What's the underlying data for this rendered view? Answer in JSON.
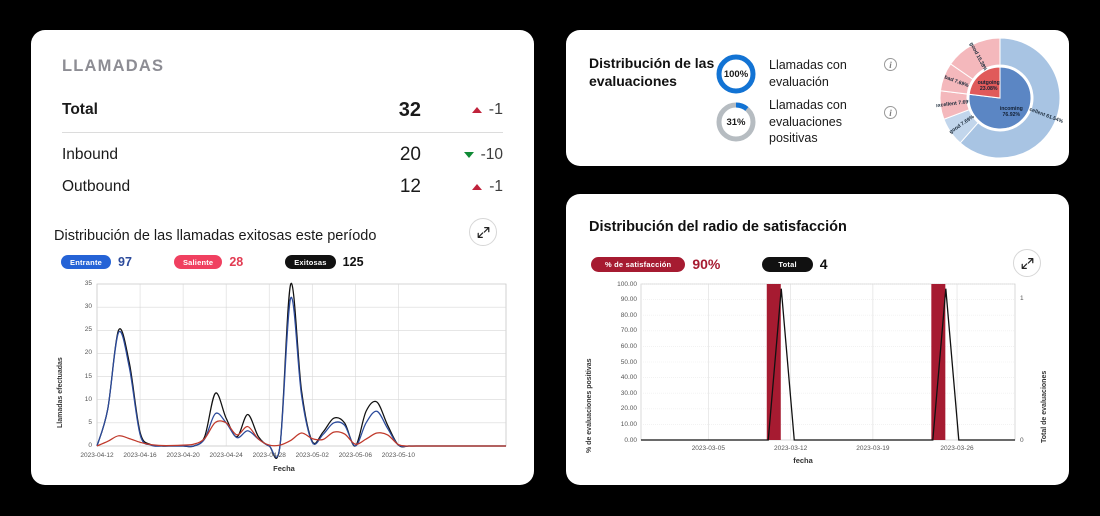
{
  "theme": {
    "background": "#000000",
    "card_bg": "#ffffff",
    "blue": "#1565c0",
    "red": "#e23b52",
    "black": "#111111",
    "crimson": "#a61b31",
    "green": "#0f8a35"
  },
  "calls_card": {
    "title": "LLAMADAS",
    "rows": [
      {
        "label": "Total",
        "value": "32",
        "delta": "-1",
        "trend": "up"
      },
      {
        "label": "Inbound",
        "value": "20",
        "delta": "-10",
        "trend": "down"
      },
      {
        "label": "Outbound",
        "value": "12",
        "delta": "-1",
        "trend": "up"
      }
    ],
    "chart_title": "Distribución de las llamadas exitosas este período",
    "expand_icon": "expand-diagonal-icon",
    "legend": [
      {
        "pill": "Entrante",
        "value": "97",
        "color": "#2563d6"
      },
      {
        "pill": "Saliente",
        "value": "28",
        "color": "#f04060"
      },
      {
        "pill": "Exitosas",
        "value": "125",
        "color": "#111111"
      }
    ]
  },
  "eval_card": {
    "title": "Distribución de las evaluaciones",
    "rows": [
      {
        "pct": "100%",
        "pct_num": 100,
        "label": "Llamadas con evaluación",
        "color": "#1273d4",
        "info": "info-icon"
      },
      {
        "pct": "31%",
        "pct_num": 31,
        "label": "Llamadas con evaluaciones positivas",
        "color": "#9aa0a6",
        "info": "info-icon"
      }
    ]
  },
  "sat_card": {
    "title": "Distribución del radio de satisfacción",
    "expand_icon": "expand-diagonal-icon",
    "legend": [
      {
        "pill": "% de satisfacción",
        "value": "90%",
        "color": "#a61b31"
      },
      {
        "pill": "Total",
        "value": "4",
        "color": "#111111"
      }
    ]
  },
  "chart_data": [
    {
      "type": "line",
      "title": "Distribución de las llamadas exitosas este período",
      "xlabel": "Fecha",
      "ylabel": "Llamadas efectuadas",
      "ylim": [
        0,
        35
      ],
      "yticks": [
        0,
        5,
        10,
        15,
        20,
        25,
        30,
        35
      ],
      "xticks": [
        "2023-04-12",
        "2023-04-16",
        "2023-04-20",
        "2023-04-24",
        "2023-04-28",
        "2023-05-02",
        "2023-05-06",
        "2023-05-10"
      ],
      "grid": true,
      "legend_position": "top",
      "series": [
        {
          "name": "Exitosas",
          "total": 125,
          "color": "#111111",
          "values": [
            0,
            8,
            25,
            18,
            3,
            0.3,
            0,
            0,
            0,
            0,
            2,
            11.4,
            6,
            2,
            6.8,
            2,
            0,
            0,
            35,
            12,
            1,
            3,
            6,
            5,
            0,
            7.5,
            9.5,
            4.5,
            0.2,
            0,
            0,
            0,
            0,
            0,
            0,
            0,
            0,
            0,
            0
          ]
        },
        {
          "name": "Entrante",
          "total": 97,
          "color": "#2b4a9b",
          "values": [
            0,
            8,
            24.5,
            17,
            2.5,
            0.2,
            0,
            0,
            0,
            0,
            1.5,
            7,
            5,
            1.8,
            3.3,
            1.5,
            0,
            0,
            32,
            11,
            0.8,
            2.5,
            5,
            4.5,
            0,
            5,
            7.5,
            3.8,
            0.2,
            0,
            0,
            0,
            0,
            0,
            0,
            0,
            0,
            0,
            0
          ]
        },
        {
          "name": "Saliente",
          "total": 28,
          "color": "#c0392b",
          "values": [
            0,
            1,
            2.2,
            1.6,
            0.8,
            0.3,
            0.1,
            0.1,
            0.2,
            0.4,
            1.6,
            5.1,
            5,
            2.4,
            4.2,
            1.5,
            0.2,
            0.2,
            1.2,
            2.8,
            1.6,
            1.4,
            3,
            2.6,
            0.4,
            1.5,
            2.8,
            2.4,
            0.3,
            0,
            0,
            0,
            0,
            0,
            0,
            0,
            0,
            0,
            0
          ]
        }
      ]
    },
    {
      "type": "line",
      "title": "Distribución del radio de satisfacción",
      "xlabel": "fecha",
      "ylabel": "% de evaluaciones positivas",
      "y2label": "Total de evaluaciones",
      "ylim": [
        0,
        100
      ],
      "yticks": [
        "0.00",
        "10.00",
        "20.00",
        "30.00",
        "40.00",
        "50.00",
        "60.00",
        "70.00",
        "80.00",
        "90.00",
        "100.00"
      ],
      "y2ticks": [
        "0",
        "1"
      ],
      "y2lim": [
        0,
        1.1
      ],
      "xticks": [
        "2023-03-05",
        "2023-03-12",
        "2023-03-19",
        "2023-03-26"
      ],
      "grid": true,
      "series": [
        {
          "name": "% de satisfacción",
          "total": "90%",
          "color": "#a61b31",
          "type": "bar",
          "bars": [
            {
              "x": 0.355,
              "h": 1.0
            },
            {
              "x": 0.795,
              "h": 1.0
            }
          ]
        },
        {
          "name": "Total",
          "total": "4",
          "color": "#111111",
          "type": "line",
          "peaks": [
            {
              "x": 0.375,
              "h": 1.0
            },
            {
              "x": 0.815,
              "h": 1.0
            }
          ]
        }
      ]
    },
    {
      "type": "pie",
      "title": "Distribución de las evaluaciones",
      "rings": [
        {
          "name": "inner",
          "slices": [
            {
              "label": "incoming 76.92%",
              "value": 76.92,
              "color": "#5b86c4"
            },
            {
              "label": "outgoing 23.08%",
              "value": 23.08,
              "color": "#e05a5a"
            }
          ]
        },
        {
          "name": "outer",
          "slices": [
            {
              "label": "excellent 61.54%",
              "value": 61.54,
              "color": "#a8c4e3"
            },
            {
              "label": "good 7.69%",
              "value": 7.69,
              "color": "#c2d6ec"
            },
            {
              "label": "excellent 7.69%",
              "value": 7.69,
              "color": "#f4b8bc"
            },
            {
              "label": "bad 7.69%",
              "value": 7.69,
              "color": "#f4b8bc"
            },
            {
              "label": "good 15.38%",
              "value": 15.38,
              "color": "#f4b8bc"
            }
          ]
        }
      ]
    }
  ]
}
